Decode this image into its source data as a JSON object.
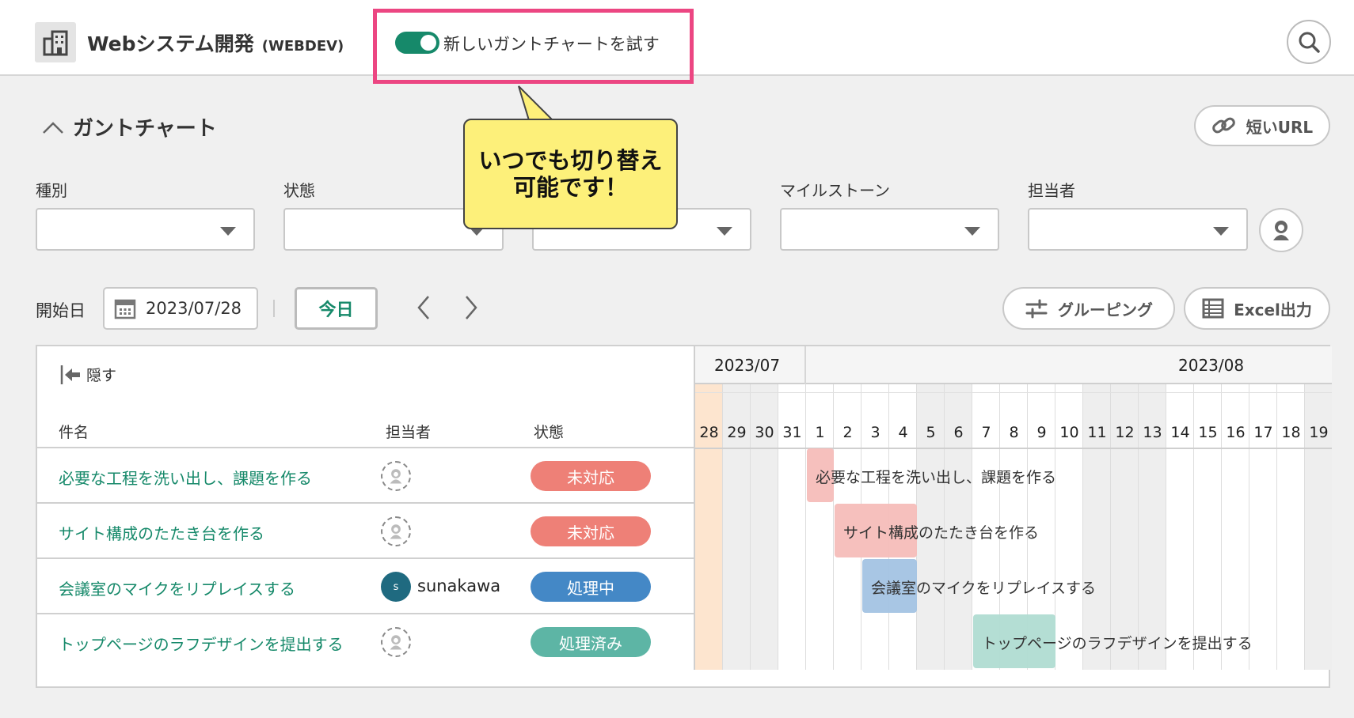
{
  "header": {
    "project_name": "Webシステム開発",
    "project_key": "(WEBDEV)",
    "toggle_label": "新しいガントチャートを試す",
    "toggle_on": true
  },
  "section": {
    "title": "ガントチャート",
    "short_url_label": "短いURL"
  },
  "tooltip": {
    "line1": "いつでも切り替え",
    "line2": "可能です！"
  },
  "filters": [
    {
      "label": "種別",
      "value": ""
    },
    {
      "label": "状態",
      "value": ""
    },
    {
      "label": "",
      "value": ""
    },
    {
      "label": "マイルストーン",
      "value": ""
    },
    {
      "label": "担当者",
      "value": ""
    }
  ],
  "toolbar": {
    "start_label": "開始日",
    "start_date": "2023/07/28",
    "today_label": "今日",
    "grouping_label": "グルーピング",
    "excel_label": "Excel出力"
  },
  "table": {
    "hide_label": "隠す",
    "columns": [
      "件名",
      "担当者",
      "状態"
    ],
    "rows": [
      {
        "title": "必要な工程を洗い出し、課題を作る",
        "assignee": "",
        "status": "未対応",
        "status_color": "#ee8077",
        "bar_color": "#f5bdb9",
        "start": 4,
        "end": 4
      },
      {
        "title": "サイト構成のたたき台を作る",
        "assignee": "",
        "status": "未対応",
        "status_color": "#ee8077",
        "bar_color": "#f5bdb9",
        "start": 5,
        "end": 7
      },
      {
        "title": "会議室のマイクをリプレイスする",
        "assignee": "sunakawa",
        "assignee_initial": "s",
        "status": "処理中",
        "status_color": "#4488c6",
        "bar_color": "#a3c3e3",
        "start": 6,
        "end": 7
      },
      {
        "title": "トップページのラフデザインを提出する",
        "assignee": "",
        "status": "処理済み",
        "status_color": "#5db5a5",
        "bar_color": "#b0dcd2",
        "start": 10,
        "end": 12
      }
    ]
  },
  "gantt": {
    "months": [
      "2023/07",
      "2023/08"
    ],
    "days": [
      {
        "d": "28",
        "type": "today"
      },
      {
        "d": "29",
        "type": "off"
      },
      {
        "d": "30",
        "type": "off"
      },
      {
        "d": "31",
        "type": ""
      },
      {
        "d": "1",
        "type": ""
      },
      {
        "d": "2",
        "type": ""
      },
      {
        "d": "3",
        "type": ""
      },
      {
        "d": "4",
        "type": ""
      },
      {
        "d": "5",
        "type": "off"
      },
      {
        "d": "6",
        "type": "off"
      },
      {
        "d": "7",
        "type": ""
      },
      {
        "d": "8",
        "type": ""
      },
      {
        "d": "9",
        "type": ""
      },
      {
        "d": "10",
        "type": ""
      },
      {
        "d": "11",
        "type": "off"
      },
      {
        "d": "12",
        "type": "off"
      },
      {
        "d": "13",
        "type": "off"
      },
      {
        "d": "14",
        "type": ""
      },
      {
        "d": "15",
        "type": ""
      },
      {
        "d": "16",
        "type": ""
      },
      {
        "d": "17",
        "type": ""
      },
      {
        "d": "18",
        "type": ""
      },
      {
        "d": "19",
        "type": "off"
      }
    ]
  },
  "colors": {
    "accent": "#16896a",
    "highlight": "#ec4682",
    "tooltip": "#fdf07a",
    "today": "#fde5cf",
    "offday": "#eeeeee"
  }
}
